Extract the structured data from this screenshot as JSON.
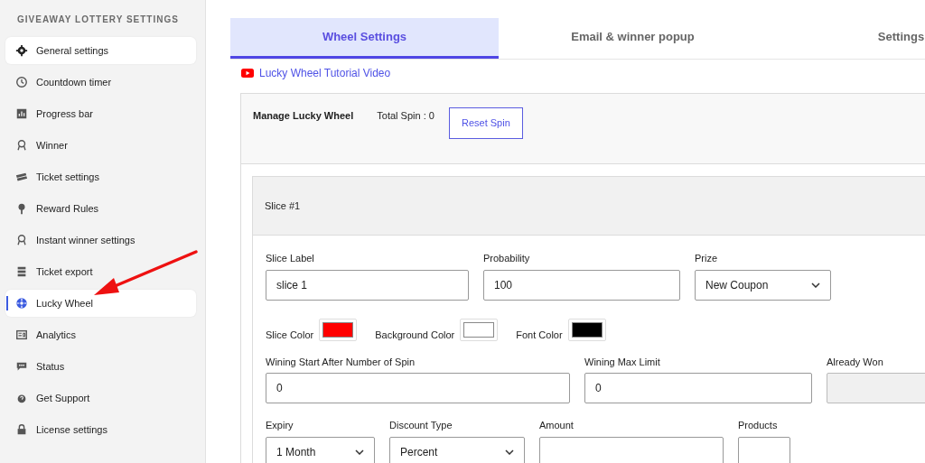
{
  "sidebar": {
    "title": "GIVEAWAY LOTTERY SETTINGS",
    "items": [
      {
        "label": "General settings",
        "highlighted": true,
        "selected": false
      },
      {
        "label": "Countdown timer",
        "highlighted": false,
        "selected": false
      },
      {
        "label": "Progress bar",
        "highlighted": false,
        "selected": false
      },
      {
        "label": "Winner",
        "highlighted": false,
        "selected": false
      },
      {
        "label": "Ticket settings",
        "highlighted": false,
        "selected": false
      },
      {
        "label": "Reward Rules",
        "highlighted": false,
        "selected": false
      },
      {
        "label": "Instant winner settings",
        "highlighted": false,
        "selected": false
      },
      {
        "label": "Ticket export",
        "highlighted": false,
        "selected": false
      },
      {
        "label": "Lucky Wheel",
        "highlighted": true,
        "selected": true
      },
      {
        "label": "Analytics",
        "highlighted": false,
        "selected": false
      },
      {
        "label": "Status",
        "highlighted": false,
        "selected": false
      },
      {
        "label": "Get Support",
        "highlighted": false,
        "selected": false
      },
      {
        "label": "License settings",
        "highlighted": false,
        "selected": false
      }
    ]
  },
  "tabs": [
    {
      "label": "Wheel Settings",
      "selected": true
    },
    {
      "label": "Email & winner popup",
      "selected": false
    },
    {
      "label": "Settings",
      "selected": false
    }
  ],
  "tutorial_link": "Lucky Wheel Tutorial Video",
  "manage": {
    "title": "Manage Lucky Wheel",
    "total_spin": "Total Spin : 0",
    "reset_button": "Reset Spin"
  },
  "slice": {
    "title": "Slice #1",
    "fields": [
      {
        "kind": "input",
        "label": "Slice Label",
        "value": "slice 1"
      },
      {
        "kind": "input",
        "label": "Probability",
        "value": "100"
      },
      {
        "kind": "select",
        "label": "Prize",
        "value": "New Coupon"
      },
      {
        "kind": "color",
        "label": "Slice Color",
        "color": "#ff0000"
      },
      {
        "kind": "color",
        "label": "Background Color",
        "color": "#ffffff"
      },
      {
        "kind": "color",
        "label": "Font Color",
        "color": "#000000"
      },
      {
        "kind": "input",
        "label": "Wining Start After Number of Spin",
        "value": "0"
      },
      {
        "kind": "input",
        "label": "Wining Max Limit",
        "value": "0"
      },
      {
        "kind": "input",
        "label": "Already Won",
        "disabled": true
      },
      {
        "kind": "select",
        "label": "Expiry",
        "value": "1 Month"
      },
      {
        "kind": "select",
        "label": "Discount Type",
        "value": "Percent"
      },
      {
        "kind": "input",
        "label": "Amount"
      },
      {
        "kind": "input",
        "label": "Products"
      }
    ]
  }
}
